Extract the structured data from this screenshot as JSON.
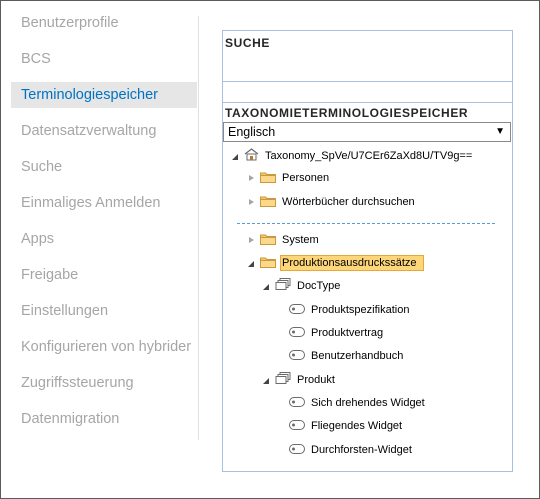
{
  "nav": {
    "items": [
      {
        "label": "Benutzerprofile",
        "active": false
      },
      {
        "label": "BCS",
        "active": false
      },
      {
        "label": "Terminologiespeicher",
        "active": true
      },
      {
        "label": "Datensatzverwaltung",
        "active": false
      },
      {
        "label": "Suche",
        "active": false
      },
      {
        "label": "Einmaliges Anmelden",
        "active": false
      },
      {
        "label": "Apps",
        "active": false
      },
      {
        "label": "Freigabe",
        "active": false
      },
      {
        "label": "Einstellungen",
        "active": false
      },
      {
        "label": "Konfigurieren von hybrider",
        "active": false
      },
      {
        "label": "Zugriffssteuerung",
        "active": false
      },
      {
        "label": "Datenmigration",
        "active": false
      }
    ]
  },
  "search": {
    "title": "SUCHE"
  },
  "taxonomy": {
    "title": "TAXONOMIETERMINOLOGIESPEICHER",
    "language": "Englisch",
    "tree": {
      "root": "Taxonomy_SpVe/U7CEr6ZaXd8U/TV9g==",
      "group_personen": "Personen",
      "group_woerterbuecher": "Wörterbücher durchsuchen",
      "group_system": "System",
      "group_produktion": "Produktionsausdruckssätze",
      "termset_doctype": "DocType",
      "term_produktspezifikation": "Produktspezifikation",
      "term_produktvertrag": "Produktvertrag",
      "term_benutzerhandbuch": "Benutzerhandbuch",
      "termset_produkt": "Produkt",
      "term_sich_drehendes": "Sich drehendes Widget",
      "term_fliegendes": "Fliegendes Widget",
      "term_durchforsten": "Durchforsten-Widget"
    }
  },
  "icons": {
    "root": "building-icon",
    "group": "folder-icon",
    "termset": "termset-icon",
    "term": "term-icon"
  },
  "colors": {
    "accent": "#0072c6",
    "selection": "#fdd67a",
    "panel_border": "#a6c2e0"
  }
}
